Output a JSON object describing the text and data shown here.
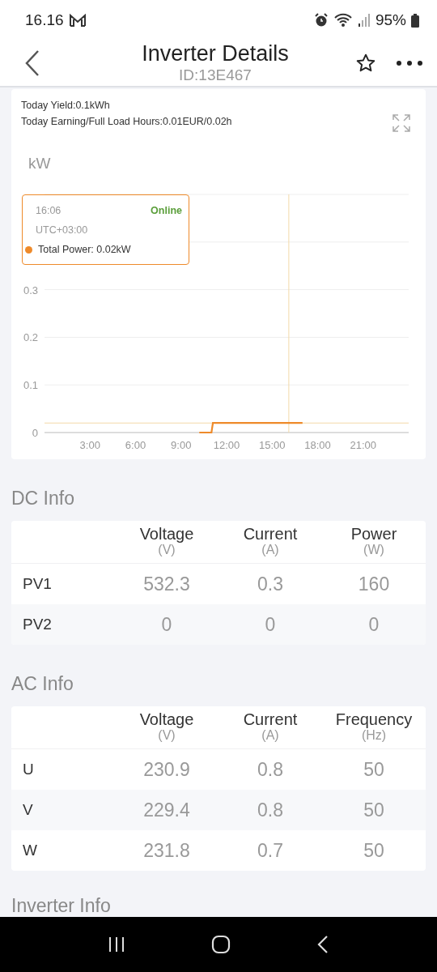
{
  "status_bar": {
    "time": "16.16",
    "battery": "95%"
  },
  "header": {
    "title": "Inverter Details",
    "subtitle": "ID:13E467"
  },
  "summary": {
    "lines": [
      "Today Yield:0.1kWh",
      "Today Earning/Full Load Hours:0.01EUR/0.02h"
    ]
  },
  "chart": {
    "unit": "kW",
    "chart_data": {
      "type": "line",
      "x": [
        10.2,
        11.0,
        11.1,
        17.0
      ],
      "series": [
        {
          "color": "#ee8a2a",
          "values": [
            0,
            0,
            0.02,
            0.02
          ]
        }
      ],
      "xlim": [
        0,
        24
      ],
      "ylim": [
        0,
        0.5
      ],
      "xticks": [
        {
          "value": 3,
          "label": "3:00"
        },
        {
          "value": 6,
          "label": "6:00"
        },
        {
          "value": 9,
          "label": "9:00"
        },
        {
          "value": 12,
          "label": "12:00"
        },
        {
          "value": 15,
          "label": "15:00"
        },
        {
          "value": 18,
          "label": "18:00"
        },
        {
          "value": 21,
          "label": "21:00"
        }
      ],
      "yticks": [
        {
          "value": 0,
          "label": "0"
        },
        {
          "value": 0.1,
          "label": "0.1"
        },
        {
          "value": 0.2,
          "label": "0.2"
        },
        {
          "value": 0.3,
          "label": "0.3"
        }
      ],
      "grid": true,
      "ref_lines": [
        {
          "axis": "x",
          "value": 16.1,
          "color": "#f3d9a8"
        },
        {
          "axis": "y",
          "value": 0.02,
          "color": "#f3d9a8"
        }
      ]
    },
    "tooltip": {
      "time": "16:06",
      "timezone": "UTC+03:00",
      "status": "Online",
      "online": true,
      "item": "Total Power: 0.02kW"
    }
  },
  "dc_info": {
    "title": "DC Info",
    "columns": [
      {
        "name": "Voltage",
        "unit": "(V)"
      },
      {
        "name": "Current",
        "unit": "(A)"
      },
      {
        "name": "Power",
        "unit": "(W)"
      }
    ],
    "rows": [
      {
        "label": "PV1",
        "values": [
          "532.3",
          "0.3",
          "160"
        ]
      },
      {
        "label": "PV2",
        "values": [
          "0",
          "0",
          "0"
        ]
      }
    ]
  },
  "ac_info": {
    "title": "AC Info",
    "columns": [
      {
        "name": "Voltage",
        "unit": "(V)"
      },
      {
        "name": "Current",
        "unit": "(A)"
      },
      {
        "name": "Frequency",
        "unit": "(Hz)"
      }
    ],
    "rows": [
      {
        "label": "U",
        "values": [
          "230.9",
          "0.8",
          "50"
        ]
      },
      {
        "label": "V",
        "values": [
          "229.4",
          "0.8",
          "50"
        ]
      },
      {
        "label": "W",
        "values": [
          "231.8",
          "0.7",
          "50"
        ]
      }
    ]
  },
  "inverter_info": {
    "title": "Inverter Info"
  }
}
